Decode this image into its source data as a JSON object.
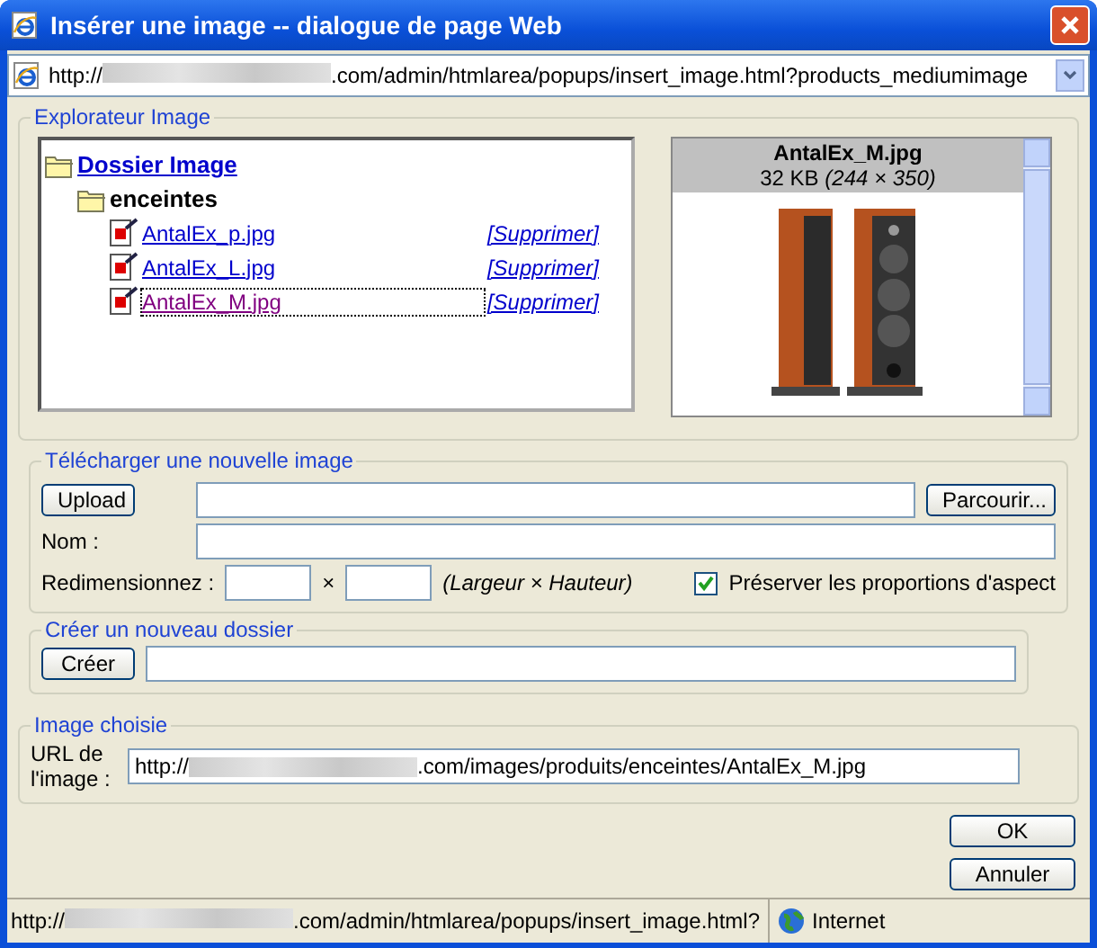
{
  "window": {
    "title": "Insérer une image -- dialogue de page Web"
  },
  "address_bar": {
    "url_prefix": "http://",
    "url_suffix": ".com/admin/htmlarea/popups/insert_image.html?products_mediumimage"
  },
  "explorer": {
    "legend": "Explorateur Image",
    "root": {
      "label": "Dossier Image",
      "children": [
        {
          "label": "enceintes",
          "children": [
            {
              "label": "AntalEx_p.jpg",
              "action": "[Supprimer]",
              "selected": false
            },
            {
              "label": "AntalEx_L.jpg",
              "action": "[Supprimer]",
              "selected": false
            },
            {
              "label": "AntalEx_M.jpg",
              "action": "[Supprimer]",
              "selected": true
            }
          ]
        }
      ]
    },
    "preview": {
      "filename": "AntalEx_M.jpg",
      "size": "32 KB",
      "dimensions": "(244 × 350)"
    }
  },
  "upload": {
    "legend": "Télécharger une nouvelle image",
    "upload_button": "Upload",
    "browse_button": "Parcourir...",
    "name_label": "Nom :",
    "resize_label": "Redimensionnez :",
    "times": "×",
    "resize_hint": "(Largeur × Hauteur)",
    "keep_ratio": {
      "label": "Préserver les proportions d'aspect",
      "checked": true
    }
  },
  "new_folder": {
    "legend": "Créer un nouveau dossier",
    "button": "Créer"
  },
  "chosen": {
    "legend": "Image choisie",
    "label": "URL de l'image :",
    "url_prefix": "http://",
    "url_suffix": ".com/images/produits/enceintes/AntalEx_M.jpg"
  },
  "buttons": [
    "OK",
    "Annuler"
  ],
  "status_bar": {
    "url_prefix": "http://",
    "url_suffix": ".com/admin/htmlarea/popups/insert_image.html?",
    "zone": "Internet"
  }
}
